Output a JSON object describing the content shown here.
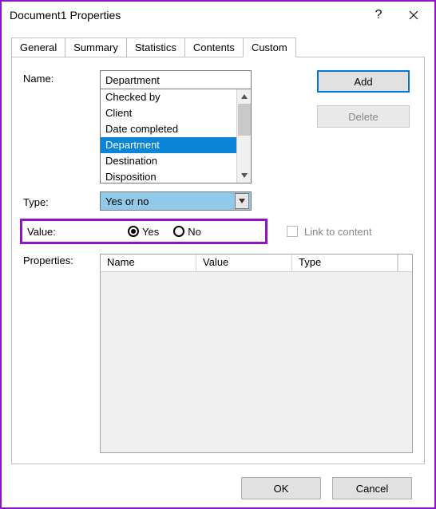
{
  "window": {
    "title": "Document1 Properties"
  },
  "tabs": [
    {
      "label": "General"
    },
    {
      "label": "Summary"
    },
    {
      "label": "Statistics"
    },
    {
      "label": "Contents"
    },
    {
      "label": "Custom",
      "active": true
    }
  ],
  "labels": {
    "name": "Name:",
    "type": "Type:",
    "value": "Value:",
    "properties": "Properties:",
    "link_to_content": "Link to content"
  },
  "name_field": {
    "value": "Department"
  },
  "name_list": {
    "items": [
      "Checked by",
      "Client",
      "Date completed",
      "Department",
      "Destination",
      "Disposition"
    ],
    "selected_index": 3
  },
  "buttons": {
    "add": "Add",
    "delete": "Delete",
    "ok": "OK",
    "cancel": "Cancel"
  },
  "type_select": {
    "value": "Yes or no"
  },
  "value_radios": {
    "yes": "Yes",
    "no": "No",
    "selected": "yes"
  },
  "link_to_content": {
    "checked": false
  },
  "properties_table": {
    "columns": [
      "Name",
      "Value",
      "Type"
    ],
    "rows": []
  }
}
